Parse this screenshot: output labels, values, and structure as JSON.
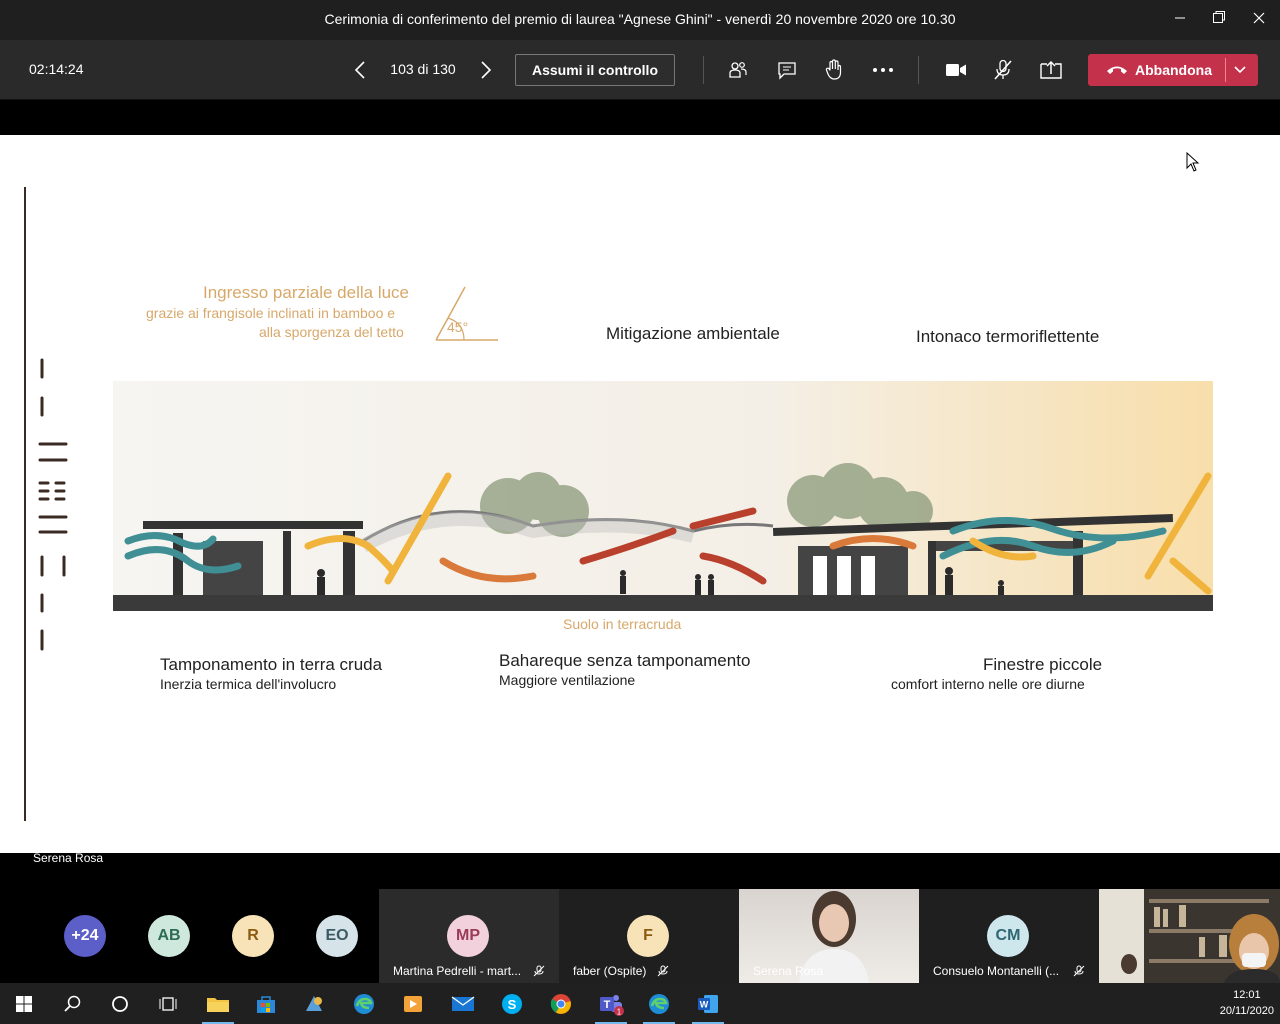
{
  "window": {
    "title": "Cerimonia di conferimento del premio di laurea \"Agnese Ghini\" - venerdì 20 novembre 2020 ore 10.30"
  },
  "toolbar": {
    "timer": "02:14:24",
    "page_counter": "103 di 130",
    "take_control_label": "Assumi il controllo",
    "leave_label": "Abbandona"
  },
  "slide": {
    "light_title": "Ingresso parziale della luce",
    "light_line1": "grazie ai frangisole inclinati in bamboo e",
    "light_line2": "alla  sporgenza del tetto",
    "angle_label": "45°",
    "mitigation": "Mitigazione ambientale",
    "plaster": "Intonaco termoriflettente",
    "ground": "Suolo in terracruda",
    "infill_title": "Tamponamento in terra cruda",
    "infill_sub": "Inerzia termica dell'involucro",
    "bahareque_title": "Bahareque senza tamponamento",
    "bahareque_sub": "Maggiore ventilazione",
    "windows_title": "Finestre piccole",
    "windows_sub": "comfort  interno nelle ore diurne"
  },
  "speaker": {
    "name": "Serena Rosa"
  },
  "participants": {
    "overflow": "+24",
    "initials": [
      "AB",
      "R",
      "EO"
    ],
    "tiles": [
      {
        "initials": "MP",
        "name": "Martina Pedrelli - mart..."
      },
      {
        "initials": "F",
        "name": "faber (Ospite)"
      },
      {
        "name": "Serena Rosa"
      },
      {
        "initials": "CM",
        "name": "Consuelo Montanelli (..."
      }
    ]
  },
  "taskbar": {
    "time": "12:01",
    "date": "20/11/2020"
  },
  "colors": {
    "leave": "#c4314b",
    "accent_gold": "#d7a86a",
    "arrow_orange": "#d9793a",
    "arrow_teal": "#3f8f94",
    "arrow_red": "#b8402d",
    "arrow_yellow": "#f0b43c"
  }
}
